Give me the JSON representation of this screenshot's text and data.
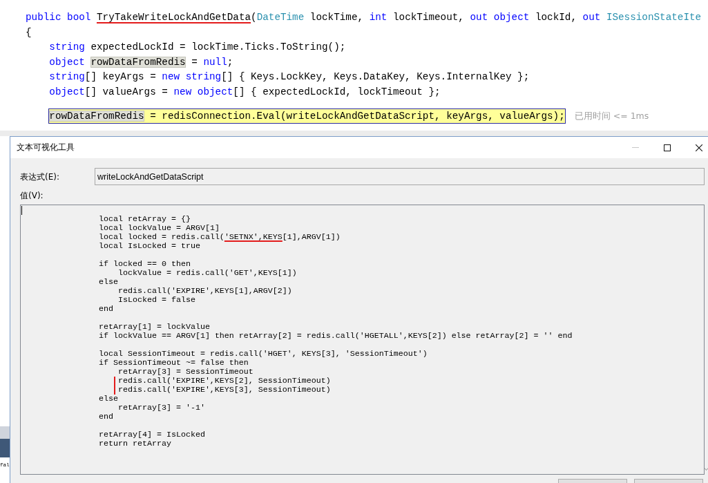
{
  "editor": {
    "lines": [
      {
        "kind": "plain",
        "tokens": [
          {
            "kind": "keyword",
            "text": "public bool "
          },
          {
            "kind": "underlined",
            "text": "TryTakeWriteLockAndGetData"
          },
          {
            "kind": "plain",
            "text": "("
          },
          {
            "kind": "type",
            "text": "DateTime"
          },
          {
            "kind": "plain",
            "text": " lockTime, "
          },
          {
            "kind": "keyword",
            "text": "int"
          },
          {
            "kind": "plain",
            "text": " lockTimeout, "
          },
          {
            "kind": "keyword",
            "text": "out object"
          },
          {
            "kind": "plain",
            "text": " lockId, "
          },
          {
            "kind": "keyword",
            "text": "out "
          },
          {
            "kind": "type",
            "text": "ISessionStateIte"
          }
        ]
      },
      {
        "kind": "plain",
        "tokens": [
          {
            "kind": "plain",
            "text": "{"
          }
        ],
        "children": [
          {
            "lines": [
              {
                "kind": "plain",
                "tokens": [
                  {
                    "kind": "keyword",
                    "text": "string"
                  },
                  {
                    "kind": "plain",
                    "text": " expectedLockId = lockTime.Ticks.ToString();"
                  }
                ]
              },
              {
                "kind": "plain",
                "tokens": [
                  {
                    "kind": "keyword",
                    "text": "object "
                  },
                  {
                    "kind": "reference",
                    "text": "rowDataFromRedis"
                  },
                  {
                    "kind": "plain",
                    "text": " = "
                  },
                  {
                    "kind": "keyword",
                    "text": "null"
                  },
                  {
                    "kind": "plain",
                    "text": ";"
                  }
                ]
              },
              {
                "kind": "plain",
                "tokens": [
                  {
                    "kind": "keyword",
                    "text": "string"
                  },
                  {
                    "kind": "plain",
                    "text": "[] keyArgs = "
                  },
                  {
                    "kind": "keyword",
                    "text": "new string"
                  },
                  {
                    "kind": "plain",
                    "text": "[] { Keys.LockKey, Keys.DataKey, Keys.InternalKey };"
                  }
                ]
              },
              {
                "kind": "plain",
                "tokens": [
                  {
                    "kind": "keyword",
                    "text": "object"
                  },
                  {
                    "kind": "plain",
                    "text": "[] valueArgs = "
                  },
                  {
                    "kind": "keyword",
                    "text": "new object"
                  },
                  {
                    "kind": "plain",
                    "text": "[] { expectedLockId, lockTimeout };"
                  }
                ]
              }
            ]
          },
          {
            "lines": [
              {
                "kind": "current",
                "tokens": [
                  {
                    "kind": "reference",
                    "text": "rowDataFromRedis"
                  },
                  {
                    "kind": "plain",
                    "text": " = redisConnection.Eval(writeLockAndGetDataScript, keyArgs, valueArgs);"
                  }
                ],
                "perf_tip": "已用时间 <= 1ms"
              }
            ]
          }
        ]
      }
    ]
  },
  "behind_window": {
    "text": "fal"
  },
  "dialog": {
    "title": "文本可视化工具",
    "controls": [
      {
        "kind": "minimize",
        "disabled": true
      },
      {
        "kind": "maximize",
        "disabled": false
      },
      {
        "kind": "close",
        "disabled": false
      }
    ],
    "expression": {
      "label": "表达式(E):",
      "value": "writeLockAndGetDataScript"
    },
    "value": {
      "label": "值(V):",
      "blocks": [
        {
          "lines": [
            {
              "kind": "plain",
              "text": "local retArray = {}"
            },
            {
              "kind": "plain",
              "text": "local lockValue = ARGV[1]"
            },
            {
              "kind": "plain",
              "tokens": [
                {
                  "kind": "plain",
                  "text": "local locked = redis.call("
                },
                {
                  "kind": "underlined",
                  "text": "'SETNX',KEYS"
                },
                {
                  "kind": "plain",
                  "text": "[1],ARGV[1])"
                }
              ]
            },
            {
              "kind": "plain",
              "text": "local IsLocked = true"
            }
          ]
        },
        {
          "lines": [
            {
              "kind": "plain",
              "text": "if locked == 0 then",
              "children": [
                {
                  "lines": [
                    {
                      "kind": "plain",
                      "text": "lockValue = redis.call('GET',KEYS[1])"
                    }
                  ]
                }
              ]
            },
            {
              "kind": "plain",
              "text": "else",
              "children": [
                {
                  "lines": [
                    {
                      "kind": "plain",
                      "text": "redis.call('EXPIRE',KEYS[1],ARGV[2])"
                    },
                    {
                      "kind": "plain",
                      "text": "IsLocked = false"
                    }
                  ]
                }
              ]
            },
            {
              "kind": "plain",
              "text": "end"
            }
          ]
        },
        {
          "lines": [
            {
              "kind": "plain",
              "text": "retArray[1] = lockValue"
            },
            {
              "kind": "plain",
              "text": "if lockValue == ARGV[1] then retArray[2] = redis.call('HGETALL',KEYS[2]) else retArray[2] = '' end"
            }
          ]
        },
        {
          "lines": [
            {
              "kind": "plain",
              "text": "local SessionTimeout = redis.call('HGET', KEYS[3], 'SessionTimeout')"
            },
            {
              "kind": "plain",
              "text": "if SessionTimeout ~= false then",
              "children": [
                {
                  "lines": [
                    {
                      "kind": "plain",
                      "text": "retArray[3] = SessionTimeout"
                    },
                    {
                      "kind": "marked",
                      "text": "redis.call('EXPIRE',KEYS[2], SessionTimeout)"
                    },
                    {
                      "kind": "marked",
                      "text": "redis.call('EXPIRE',KEYS[3], SessionTimeout)"
                    }
                  ]
                }
              ]
            },
            {
              "kind": "plain",
              "text": "else",
              "children": [
                {
                  "lines": [
                    {
                      "kind": "plain",
                      "text": "retArray[3] = '-1'"
                    }
                  ]
                }
              ]
            },
            {
              "kind": "plain",
              "text": "end"
            }
          ]
        },
        {
          "lines": [
            {
              "kind": "plain",
              "text": "retArray[4] = IsLocked"
            },
            {
              "kind": "plain",
              "text": "return retArray"
            }
          ]
        }
      ]
    }
  }
}
